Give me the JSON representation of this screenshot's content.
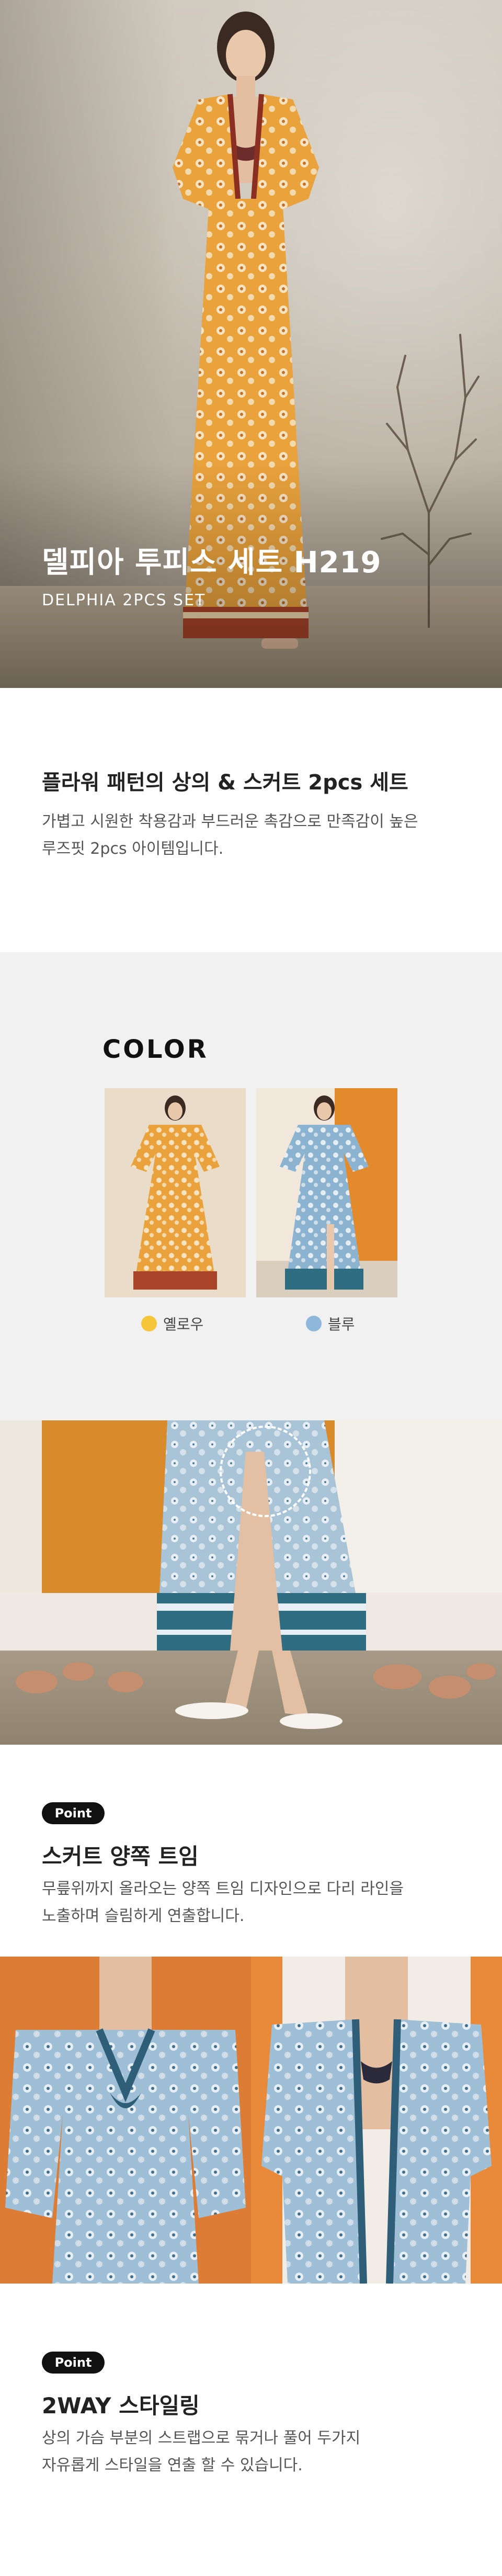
{
  "hero": {
    "title": "델피아 투피스 세트 H219",
    "subtitle": "DELPHIA 2PCS SET"
  },
  "intro": {
    "heading": "플라워 패턴의 상의 & 스커트 2pcs 세트",
    "desc_line1": "가볍고 시원한 착용감과 부드러운 촉감으로 만족감이 높은",
    "desc_line2": "루즈핏 2pcs 아이템입니다."
  },
  "color": {
    "label": "COLOR",
    "options": [
      {
        "name": "옐로우",
        "dot_color": "#f5c53a"
      },
      {
        "name": "블루",
        "dot_color": "#8fb7dc"
      }
    ]
  },
  "point1": {
    "badge": "Point",
    "title": "스커트 양쪽 트임",
    "desc_line1": "무릎위까지 올라오는 양쪽 트임 디자인으로 다리 라인을",
    "desc_line2": "노출하며 슬림하게 연출합니다."
  },
  "point2": {
    "badge": "Point",
    "title": "2WAY 스타일링",
    "desc_line1": "상의 가슴 부분의 스트랩으로 묶거나 풀어 두가지",
    "desc_line2": "자유롭게 스타일을 연출 할 수 있습니다."
  },
  "colors": {
    "yellow_print": "#e9a23c",
    "blue_print": "#8cb3cf",
    "accent_dark": "#111111"
  }
}
